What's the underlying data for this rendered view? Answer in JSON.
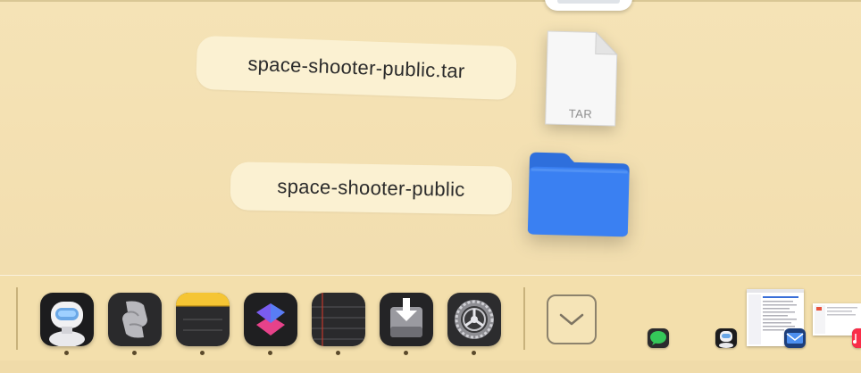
{
  "stack": {
    "items": [
      {
        "name": "space-shooter-public.tar",
        "kind": "tar-archive",
        "badge": "TAR"
      },
      {
        "name": "space-shooter-public",
        "kind": "folder"
      }
    ]
  },
  "dock": {
    "apps": [
      {
        "name": "Robot app",
        "icon": "robot-icon",
        "running": true
      },
      {
        "name": "Script Editor",
        "icon": "script-scroll-icon",
        "running": true
      },
      {
        "name": "Notes",
        "icon": "notes-icon",
        "running": true
      },
      {
        "name": "Shortcuts",
        "icon": "shortcuts-icon",
        "running": true
      },
      {
        "name": "Notebook",
        "icon": "ruled-notebook-icon",
        "running": true
      },
      {
        "name": "Installer",
        "icon": "installer-disk-icon",
        "running": true
      },
      {
        "name": "System Settings",
        "icon": "gear-icon",
        "running": true
      }
    ],
    "stack_toggle_icon": "chevron-down-icon",
    "minimized": [
      "messages-icon",
      "robot-icon",
      "mail-icon",
      "window-thumbnail",
      "window-thumbnail",
      "music-icon"
    ]
  },
  "colors": {
    "desktop": "#f3e0b2",
    "folder_blue": "#3a7ff0",
    "label_bg": "#fbf1d2"
  }
}
